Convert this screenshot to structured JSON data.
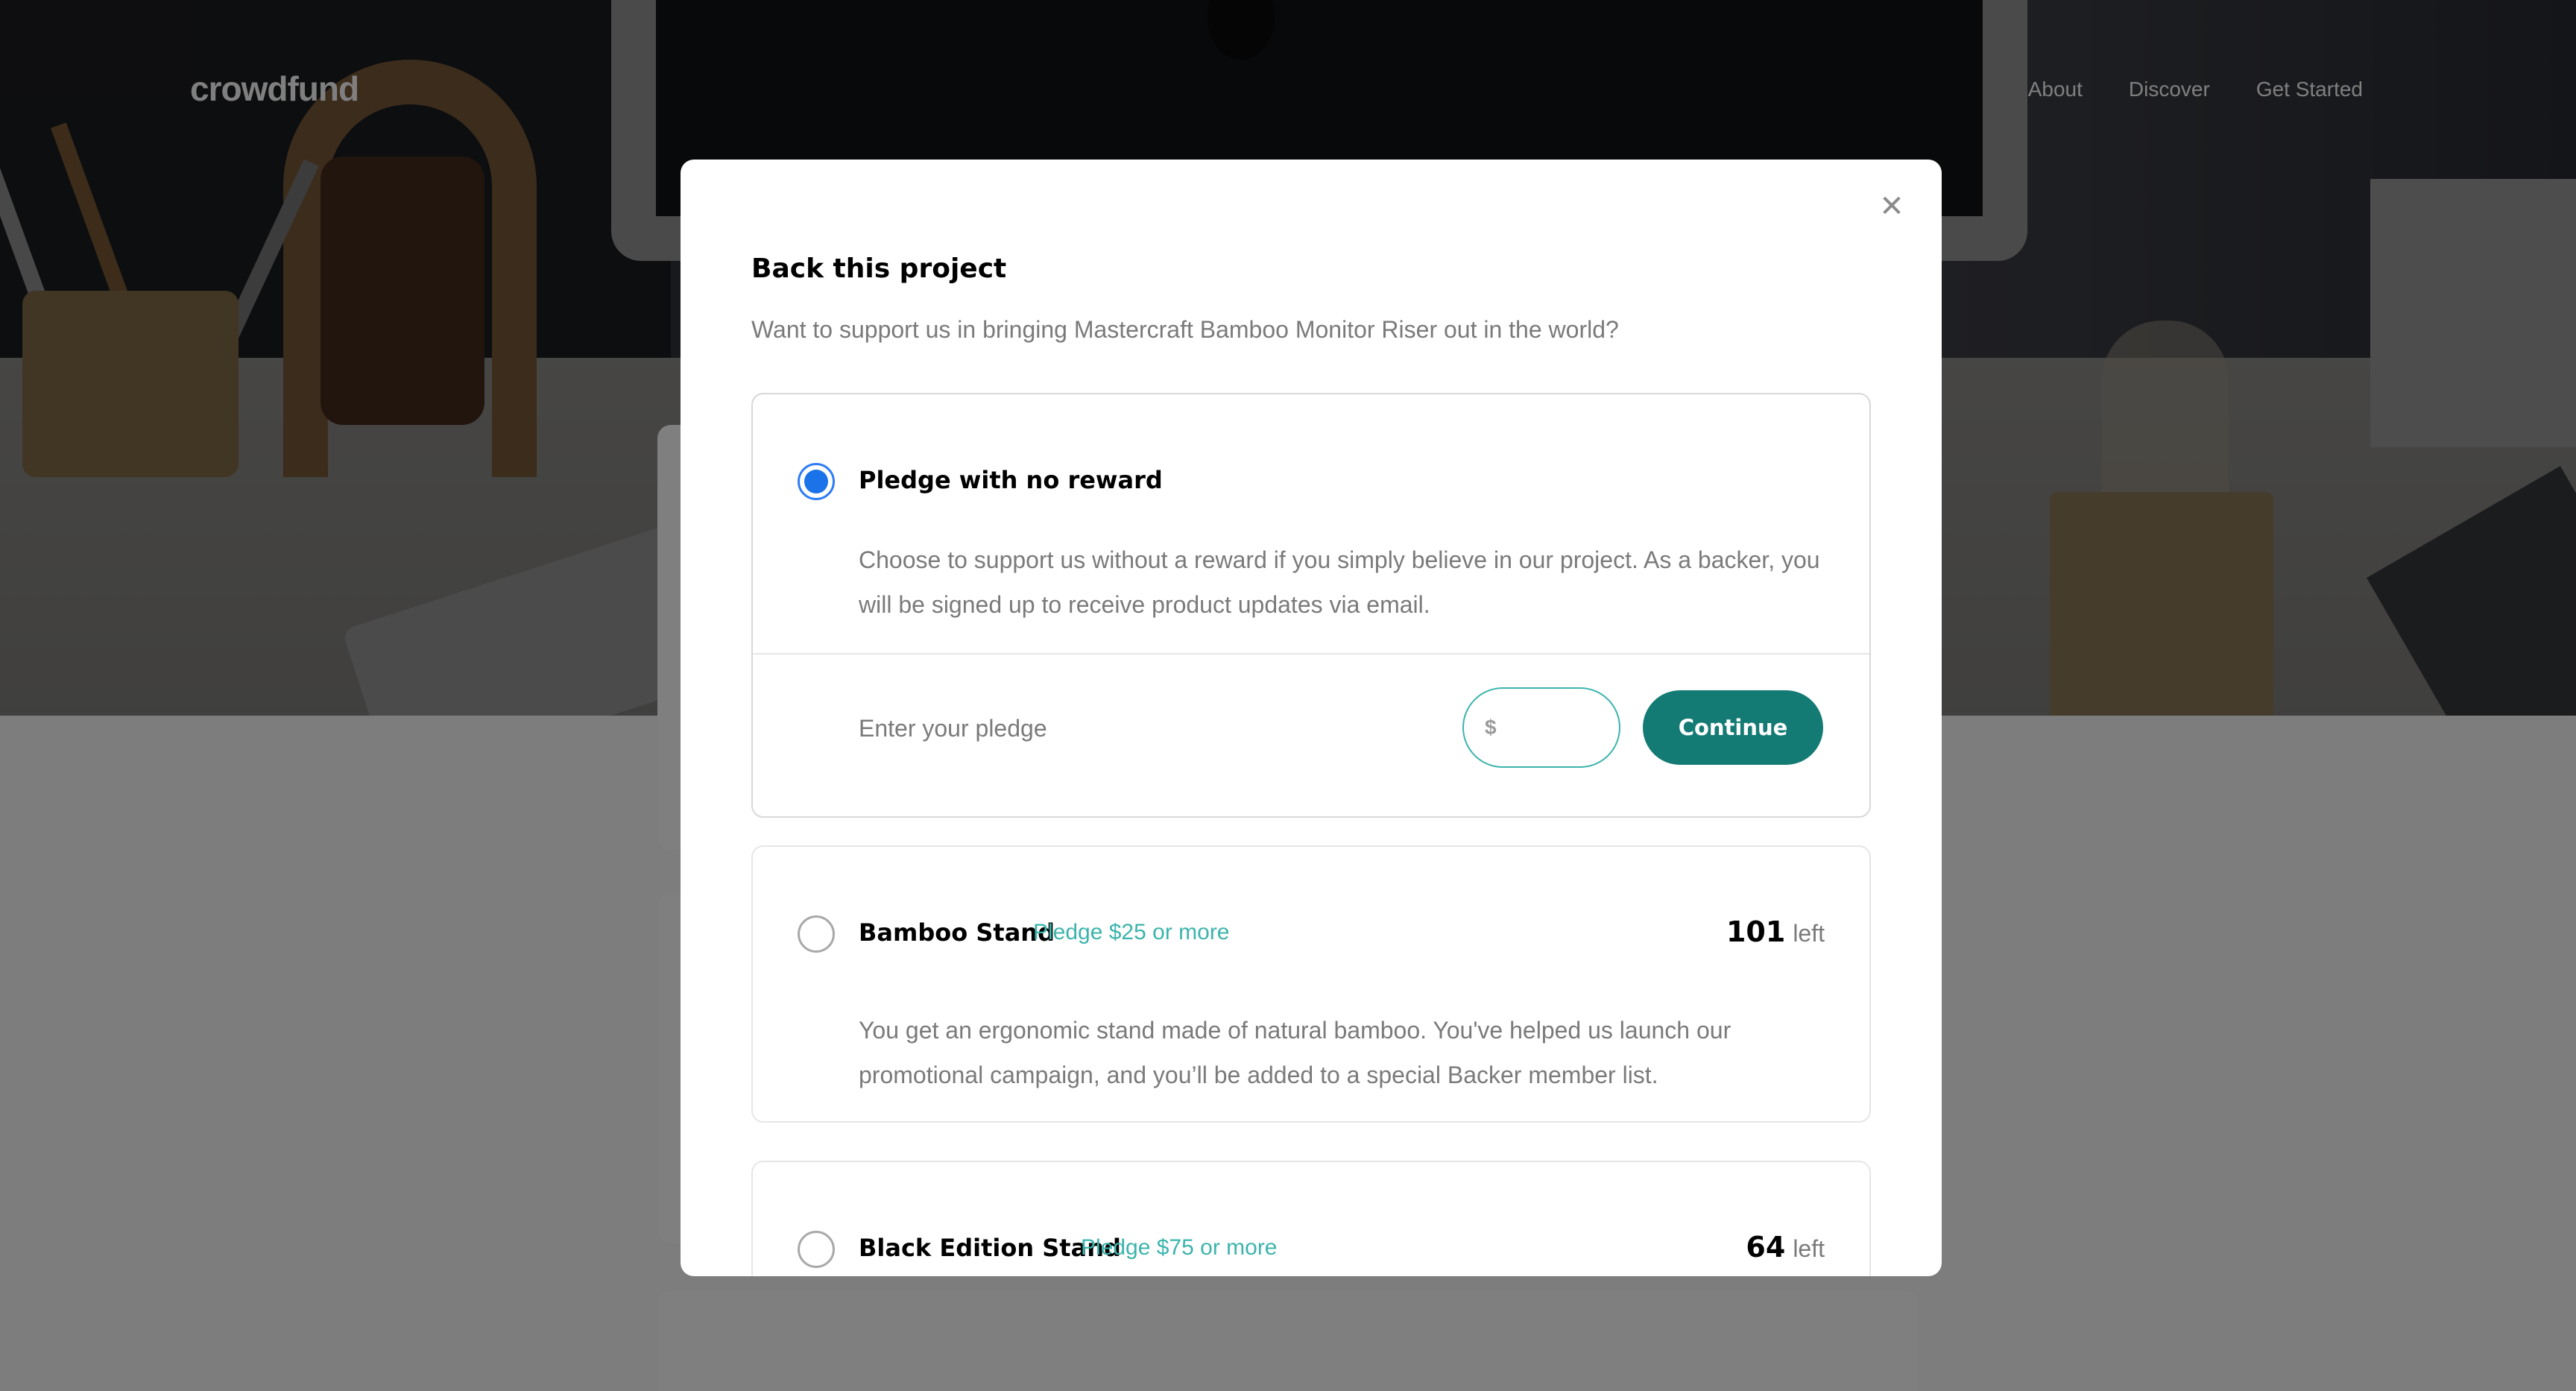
{
  "header": {
    "logo": "crowdfund",
    "nav": [
      "About",
      "Discover",
      "Get Started"
    ]
  },
  "modal": {
    "title": "Back this project",
    "subtitle": "Want to support us in bringing Mastercraft Bamboo Monitor Riser out in the world?",
    "close_icon": "close-icon",
    "options": [
      {
        "name": "Pledge with no reward",
        "pledge": "",
        "left_count": "",
        "left_label": "",
        "description": "Choose to support us without a reward if you simply believe in our project. As a backer, you will be signed up to receive product updates via email.",
        "selected": true,
        "enter_label": "Enter your pledge",
        "currency": "$",
        "amount": "",
        "continue_label": "Continue"
      },
      {
        "name": "Bamboo Stand",
        "pledge": "Pledge $25 or more",
        "left_count": "101",
        "left_label": "left",
        "description": "You get an ergonomic stand made of natural bamboo. You've helped us launch our promotional campaign, and you’ll be added to a special Backer member list.",
        "selected": false
      },
      {
        "name": "Black Edition Stand",
        "pledge": "Pledge $75 or more",
        "left_count": "64",
        "left_label": "left",
        "description": "",
        "selected": false
      }
    ]
  },
  "colors": {
    "accent": "#3cb4ac",
    "button": "#147b74",
    "radio_selected": "#1a73e8"
  }
}
